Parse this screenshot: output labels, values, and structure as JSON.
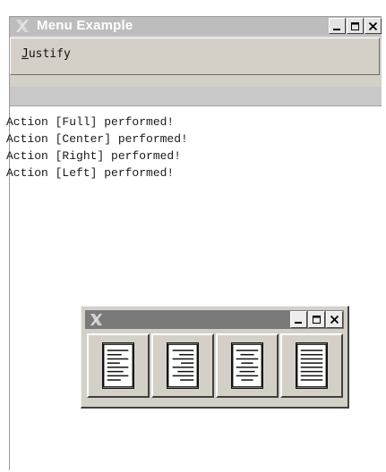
{
  "window": {
    "title": "Menu Example",
    "icon": "x-logo-icon",
    "controls": [
      "minimize-icon",
      "maximize-icon",
      "close-icon"
    ]
  },
  "menubar": {
    "items": [
      {
        "label": "Justify",
        "mnemonic": "J"
      }
    ]
  },
  "log": {
    "lines": [
      "Action [Full] performed!",
      "Action [Center] performed!",
      "Action [Right] performed!",
      "Action [Left] performed!"
    ]
  },
  "palette": {
    "icon": "x-logo-icon",
    "controls": [
      "minimize-icon",
      "maximize-icon",
      "close-icon"
    ],
    "buttons": [
      {
        "name": "justify-left",
        "icon": "align-left-icon"
      },
      {
        "name": "justify-right",
        "icon": "align-right-icon"
      },
      {
        "name": "justify-center",
        "icon": "align-center-icon"
      },
      {
        "name": "justify-full",
        "icon": "align-full-icon"
      }
    ]
  },
  "colors": {
    "window_bg": "#d4d0c8",
    "titlebar_inactive": "#bdbdbd",
    "palette_titlebar": "#7a7a7a",
    "text_area": "#ffffff"
  }
}
